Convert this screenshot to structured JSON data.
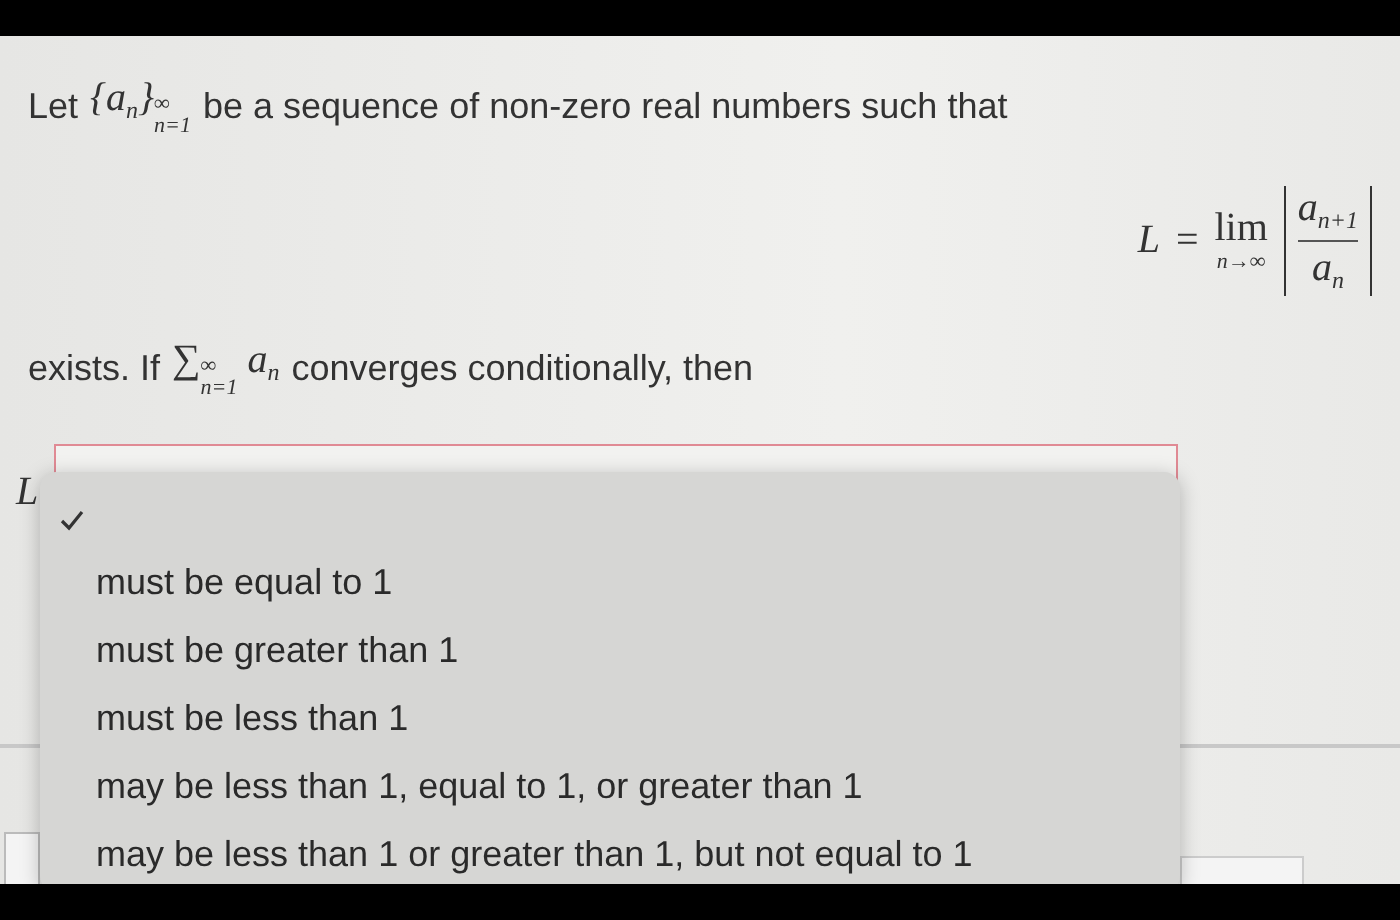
{
  "intro": {
    "before": "Let",
    "open": "{",
    "symbol": "a",
    "index": "n",
    "close": "}",
    "upper": "∞",
    "lower": "n=1",
    "after": "be a sequence of non-zero real numbers such that"
  },
  "formula": {
    "lhs": "L",
    "eq": "=",
    "lim": "lim",
    "under": "n→∞",
    "num_symbol": "a",
    "num_index": "n+1",
    "den_symbol": "a",
    "den_index": "n"
  },
  "condition": {
    "before": "exists. If",
    "sigma": "∑",
    "upper": "∞",
    "lower": "n=1",
    "symbol": "a",
    "index": "n",
    "after": "converges conditionally, then"
  },
  "answer": {
    "label": "L",
    "blank_selected": true,
    "options": [
      {
        "label": "must be equal to 1",
        "selected": false
      },
      {
        "label": "must be greater than 1",
        "selected": false
      },
      {
        "label": "must be less than 1",
        "selected": false
      },
      {
        "label": "may be less than 1, equal to 1, or greater than 1",
        "selected": false
      },
      {
        "label": "may be less than 1 or greater than 1, but not equal to 1",
        "selected": false
      }
    ]
  }
}
